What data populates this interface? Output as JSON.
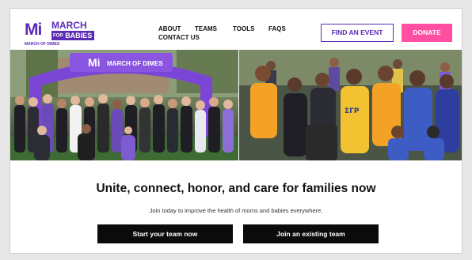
{
  "header": {
    "logo": {
      "mark": "Mi",
      "word_top": "MARCH",
      "word_for": "FOR",
      "word_babies": "BABIES",
      "sub": "MARCH OF DIMES"
    },
    "nav": {
      "about": "ABOUT",
      "contact": "CONTACT US",
      "teams": "TEAMS",
      "tools": "TOOLS",
      "faqs": "FAQS"
    },
    "find_event_label": "FIND AN EVENT",
    "donate_label": "DONATE"
  },
  "hero": {
    "left_photo": {
      "arch_text": "MARCH OF DIMES",
      "arch_mark": "Mi"
    },
    "right_photo": {
      "shirt_text": "ΣΓΡ"
    }
  },
  "main": {
    "headline": "Unite, connect, honor, and care for families now",
    "subtext": "Join today to improve the health of moms and babies everywhere.",
    "start_team_label": "Start your team now",
    "join_team_label": "Join an existing team"
  },
  "colors": {
    "brand_purple": "#5b2bb5",
    "donate_pink": "#ff4fa3",
    "cta_black": "#0b0b0b"
  }
}
